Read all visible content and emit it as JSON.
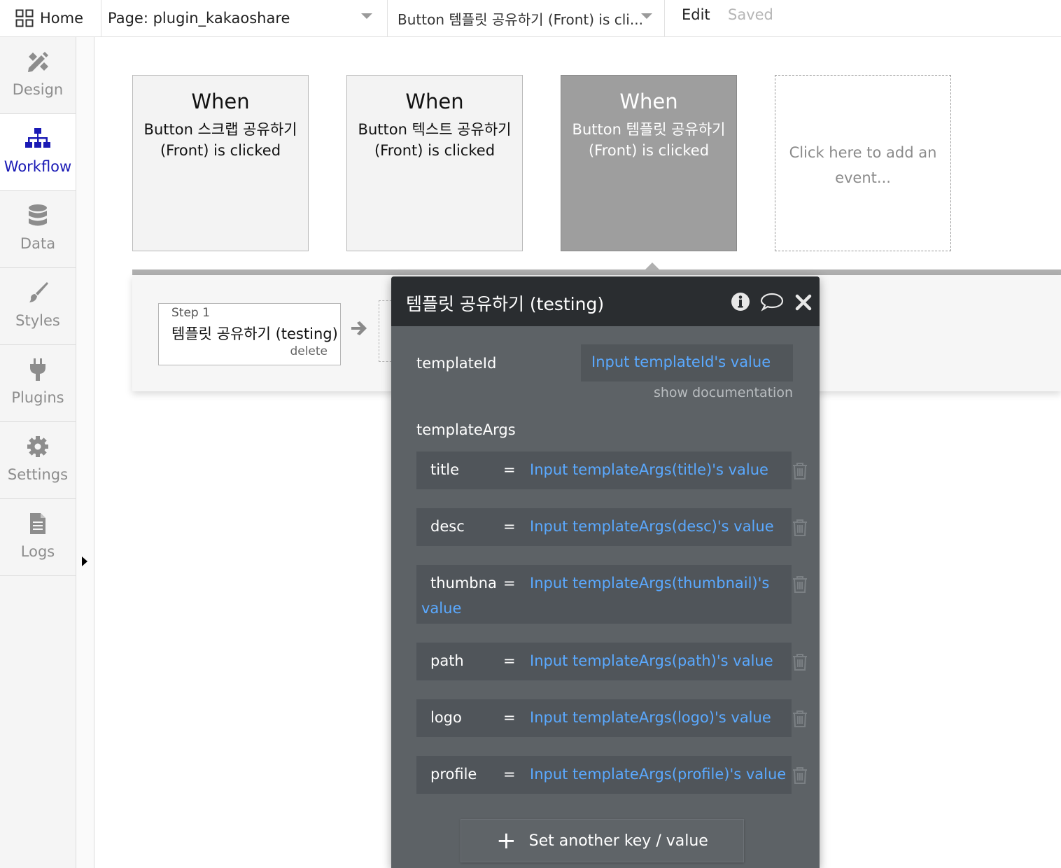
{
  "topbar": {
    "home_label": "Home",
    "page_label": "Page: plugin_kakaoshare",
    "event_label": "Button 템플릿 공유하기 (Front) is cli...",
    "edit_label": "Edit",
    "saved_label": "Saved"
  },
  "sidebar": {
    "items": [
      {
        "label": "Design",
        "icon": "design-icon"
      },
      {
        "label": "Workflow",
        "icon": "workflow-icon",
        "active": true
      },
      {
        "label": "Data",
        "icon": "database-icon"
      },
      {
        "label": "Styles",
        "icon": "brush-icon"
      },
      {
        "label": "Plugins",
        "icon": "plug-icon"
      },
      {
        "label": "Settings",
        "icon": "gear-icon"
      },
      {
        "label": "Logs",
        "icon": "document-icon"
      }
    ],
    "active_color": "#1a1ab5"
  },
  "events": [
    {
      "when": "When",
      "line1": "Button 스크랩 공유하기",
      "line2": "(Front) is clicked"
    },
    {
      "when": "When",
      "line1": "Button 텍스트 공유하기",
      "line2": "(Front) is clicked"
    },
    {
      "when": "When",
      "line1": "Button 템플릿 공유하기",
      "line2": "(Front) is clicked",
      "selected": true
    }
  ],
  "add_event": {
    "line1": "Click here to add an",
    "line2": "event..."
  },
  "step": {
    "number": "Step 1",
    "name": "템플릿 공유하기 (testing)",
    "delete_label": "delete"
  },
  "panel": {
    "title": "템플릿 공유하기 (testing)",
    "template_id_label": "templateId",
    "template_id_value": "Input templateId's value",
    "show_doc_label": "show documentation",
    "template_args_label": "templateArgs",
    "args": [
      {
        "key": "title",
        "eq": "=",
        "value": "Input templateArgs(title)'s value"
      },
      {
        "key": "desc",
        "eq": "=",
        "value": "Input templateArgs(desc)'s value"
      },
      {
        "key": "thumbnail",
        "eq": "=",
        "value": "Input templateArgs(thumbnail)'s",
        "value_cont": "value"
      },
      {
        "key": "path",
        "eq": "=",
        "value": "Input templateArgs(path)'s value"
      },
      {
        "key": "logo",
        "eq": "=",
        "value": "Input templateArgs(logo)'s value"
      },
      {
        "key": "profile",
        "eq": "=",
        "value": "Input templateArgs(profile)'s value"
      }
    ],
    "add_kv_label": "Set another key / value",
    "link_color": "#5aa9ff"
  }
}
